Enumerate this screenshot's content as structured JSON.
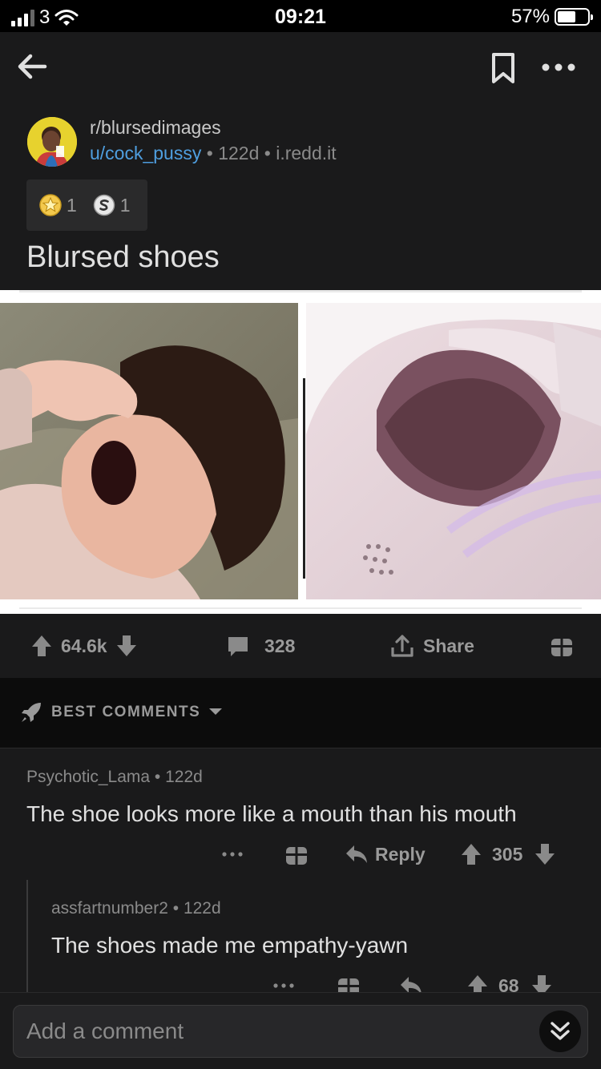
{
  "status_bar": {
    "carrier": "3",
    "time": "09:21",
    "battery": "57%"
  },
  "post": {
    "subreddit": "r/blursedimages",
    "user": "u/cock_pussy",
    "age": "122d",
    "domain": "i.redd.it",
    "separator": "•",
    "awards": [
      {
        "icon": "gold-award-icon",
        "count": "1"
      },
      {
        "icon": "silver-award-icon",
        "count": "1"
      }
    ],
    "title": "Blursed shoes"
  },
  "actions": {
    "votes": "64.6k",
    "comments": "328",
    "share": "Share"
  },
  "sort": {
    "label": "BEST COMMENTS"
  },
  "comments": [
    {
      "user": "Psychotic_Lama",
      "age": "122d",
      "body": "The shoe looks more like a mouth than his mouth",
      "reply": "Reply",
      "score": "305"
    },
    {
      "user": "assfartnumber2",
      "age": "122d",
      "body": "The shoes made me empathy-yawn",
      "score": "68"
    }
  ],
  "composer": {
    "placeholder": "Add a comment"
  },
  "colors": {
    "background": "#1a1a1b",
    "username_link": "#4f9fe0",
    "text": "#e0e0e0",
    "muted": "#8a8a8a"
  }
}
